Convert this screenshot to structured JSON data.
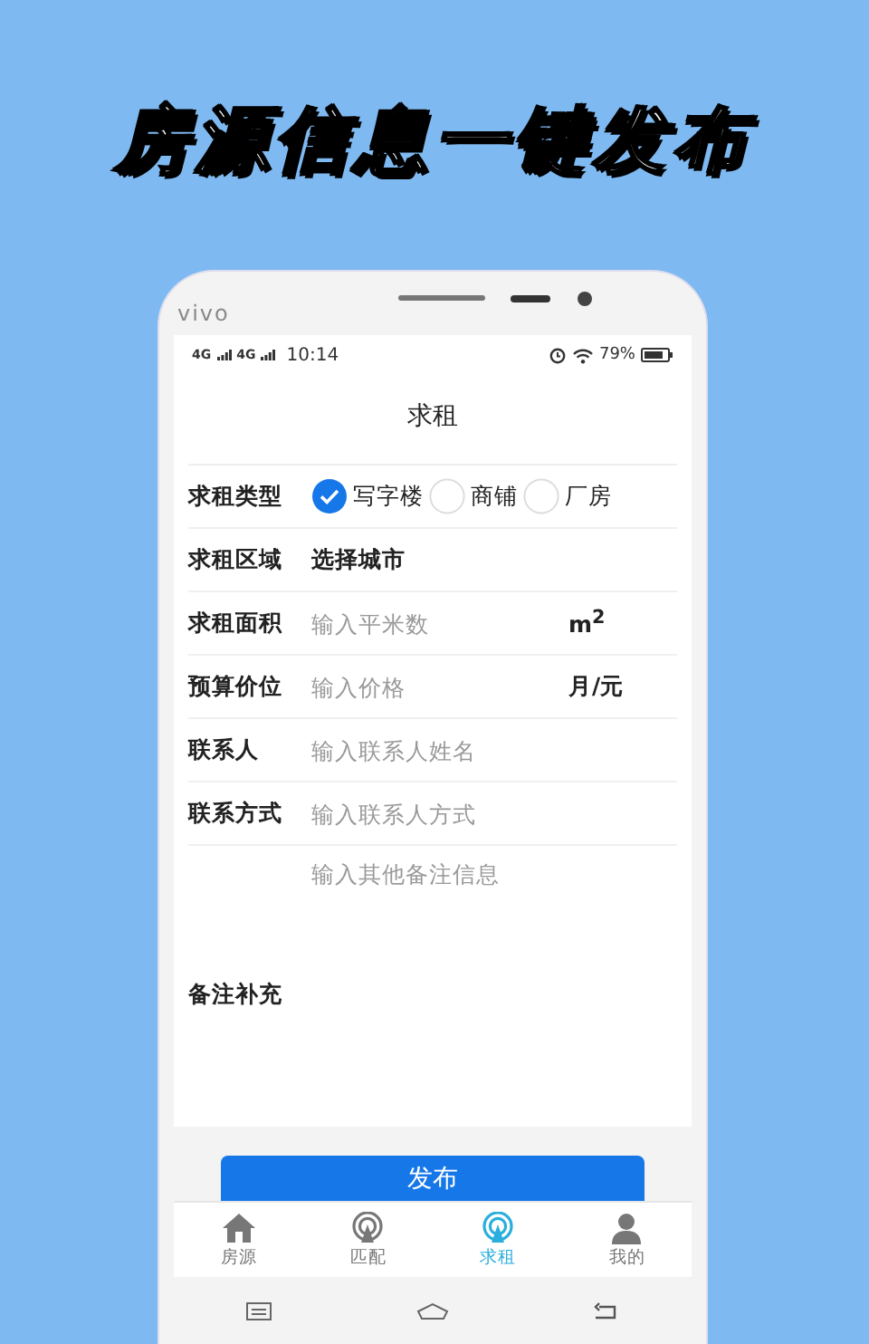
{
  "headline": "房源信息一键发布",
  "phone": {
    "brand": "vivo"
  },
  "status_bar": {
    "network_1": "4G",
    "network_2": "4G",
    "time": "10:14",
    "battery": "79%"
  },
  "title": "求租",
  "form": {
    "rows": [
      {
        "kind": "radio",
        "label": "求租类型",
        "options": [
          {
            "label": "写字楼",
            "selected": true
          },
          {
            "label": "商铺",
            "selected": false
          },
          {
            "label": "厂房",
            "selected": false
          }
        ]
      },
      {
        "kind": "select",
        "label": "求租区域",
        "value": "选择城市"
      },
      {
        "kind": "input",
        "label": "求租面积",
        "placeholder": "输入平米数",
        "unit": "m$^{2}$"
      },
      {
        "kind": "input",
        "label": "预算价位",
        "placeholder": "输入价格",
        "unit": "月/元"
      },
      {
        "kind": "input",
        "label": "联系人",
        "placeholder": "输入联系人姓名"
      },
      {
        "kind": "input",
        "label": "联系方式",
        "placeholder": "输入联系人方式"
      }
    ]
  },
  "notes": {
    "placeholder": "输入其他备注信息",
    "label": "备注补充"
  },
  "submit": "发布",
  "tabs": [
    {
      "label": "房源",
      "selected": false
    },
    {
      "label": "匹配",
      "selected": false
    },
    {
      "label": "求租",
      "selected": true
    },
    {
      "label": "我的",
      "selected": false
    }
  ]
}
